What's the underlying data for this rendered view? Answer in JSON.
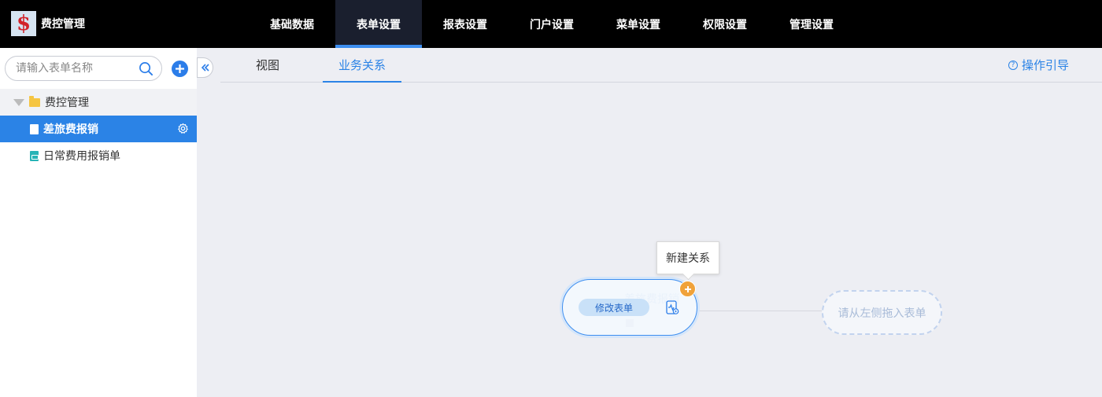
{
  "app": {
    "title": "费控管理",
    "logo_glyph": "$"
  },
  "nav": {
    "items": [
      {
        "label": "基础数据"
      },
      {
        "label": "表单设置",
        "active": true
      },
      {
        "label": "报表设置"
      },
      {
        "label": "门户设置"
      },
      {
        "label": "菜单设置"
      },
      {
        "label": "权限设置"
      },
      {
        "label": "管理设置"
      }
    ]
  },
  "sidebar": {
    "search_placeholder": "请输入表单名称",
    "tree": {
      "root_label": "费控管理",
      "items": [
        {
          "label": "差旅费报销",
          "selected": true,
          "icon_color": "#ffffff"
        },
        {
          "label": "日常费用报销单",
          "selected": false,
          "icon_color": "#27b3b6"
        }
      ]
    }
  },
  "main": {
    "tabs": [
      {
        "label": "视图",
        "active": false
      },
      {
        "label": "业务关系",
        "active": true
      }
    ],
    "guide_label": "操作引导"
  },
  "canvas": {
    "node": {
      "title": "差旅费报销",
      "edit_label": "修改表单"
    },
    "tooltip": "新建关系",
    "drop_target": "请从左侧拖入表单"
  },
  "colors": {
    "accent": "#2b83e6",
    "topbar": "#000000",
    "badge": "#f0a23a"
  }
}
